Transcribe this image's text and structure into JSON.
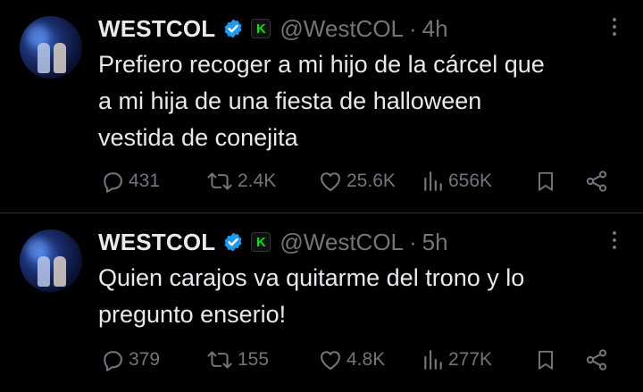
{
  "tweets": [
    {
      "name": "WESTCOL",
      "handle": "@WestCOL",
      "separator": "·",
      "time": "4h",
      "badge_letter": "K",
      "text_lines": [
        "Prefiero recoger a mi hijo de la cárcel que",
        "a mi hija de una fiesta de halloween",
        "vestida de conejita"
      ],
      "replies": "431",
      "retweets": "2.4K",
      "likes": "25.6K",
      "views": "656K"
    },
    {
      "name": "WESTCOL",
      "handle": "@WestCOL",
      "separator": "·",
      "time": "5h",
      "badge_letter": "K",
      "text_lines": [
        "Quien carajos va quitarme del trono y lo",
        "pregunto enserio!"
      ],
      "replies": "379",
      "retweets": "155",
      "likes": "4.8K",
      "views": "277K"
    }
  ],
  "colors": {
    "background": "#000000",
    "text": "#e7e9ea",
    "muted": "#71767b",
    "verified": "#1d9bf0",
    "kick_green": "#00e701"
  },
  "icons": [
    "more-dots-icon",
    "verified-icon",
    "kick-badge-icon",
    "reply-icon",
    "retweet-icon",
    "like-icon",
    "views-icon",
    "bookmark-icon",
    "share-icon"
  ]
}
